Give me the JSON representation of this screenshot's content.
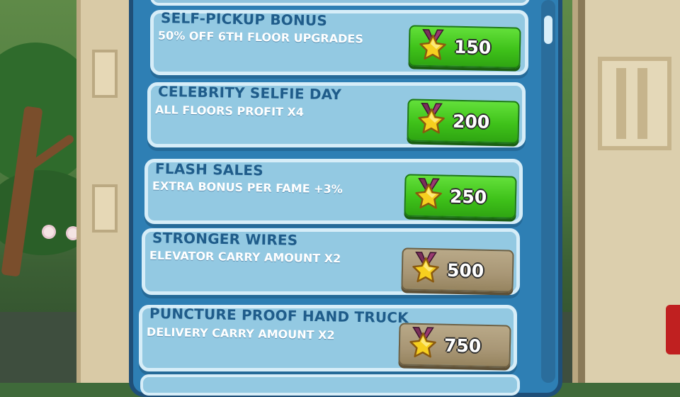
{
  "upgrades": [
    {
      "title": "SELF-PICKUP BONUS",
      "description": "50% OFF 6TH FLOOR UPGRADES",
      "price": "150",
      "state": "affordable"
    },
    {
      "title": "CELEBRITY SELFIE DAY",
      "description": "ALL FLOORS PROFIT X4",
      "price": "200",
      "state": "affordable"
    },
    {
      "title": "FLASH SALES",
      "description": "EXTRA BONUS PER FAME +3%",
      "price": "250",
      "state": "affordable"
    },
    {
      "title": "STRONGER WIRES",
      "description": "ELEVATOR CARRY AMOUNT X2",
      "price": "500",
      "state": "disabled"
    },
    {
      "title": "PUNCTURE PROOF HAND TRUCK",
      "description": "DELIVERY CARRY AMOUNT X2",
      "price": "750",
      "state": "disabled"
    }
  ],
  "icons": {
    "price_icon": "star-medal-icon"
  },
  "colors": {
    "panel": "#2e7fb4",
    "row": "#93c9e2",
    "title_text": "#1f5c8a",
    "button_affordable": "#3fc21a",
    "button_disabled": "#a89675",
    "star": "#f6cf1f",
    "ribbon": "#7a2f5a"
  }
}
